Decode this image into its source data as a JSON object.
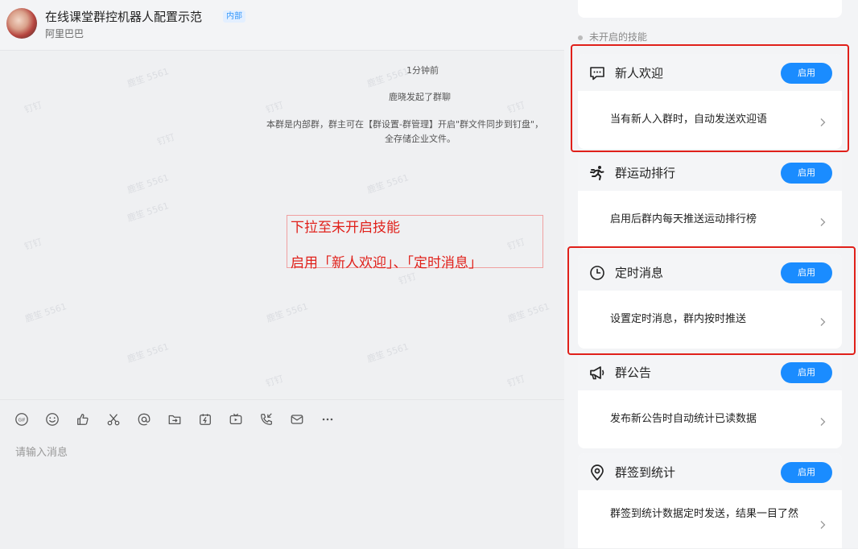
{
  "header": {
    "title": "在线课堂群控机器人配置示范",
    "badge": "内部",
    "org": "阿里巴巴"
  },
  "messages": {
    "time": "1分钟前",
    "started": "鹿晓发起了群聊",
    "notice_line1": "本群是内部群，群主可在【群设置-群管理】开启\"群文件同步到钉盘\"，",
    "notice_line2": "全存储企业文件。"
  },
  "watermarks": [
    "鹿笙 5561",
    "钉钉"
  ],
  "annotation": {
    "line1": "下拉至未开启技能",
    "line2": "启用「新人欢迎」、「定时消息」"
  },
  "composer": {
    "placeholder": "请输入消息",
    "tools": [
      "gif-icon",
      "emoji-icon",
      "thumbs-up-icon",
      "scissors-icon",
      "at-icon",
      "share-icon",
      "flash-icon",
      "tv-icon",
      "phone-icon",
      "mail-icon",
      "more-icon"
    ]
  },
  "panel": {
    "section_title": "未开启的技能",
    "skills": [
      {
        "name": "新人欢迎",
        "icon": "chat-bubble-icon",
        "button": "启用",
        "description": "当有新人入群时，自动发送欢迎语"
      },
      {
        "name": "群运动排行",
        "icon": "runner-icon",
        "button": "启用",
        "description": "启用后群内每天推送运动排行榜"
      },
      {
        "name": "定时消息",
        "icon": "clock-icon",
        "button": "启用",
        "description": "设置定时消息，群内按时推送"
      },
      {
        "name": "群公告",
        "icon": "megaphone-icon",
        "button": "启用",
        "description": "发布新公告时自动统计已读数据"
      },
      {
        "name": "群签到统计",
        "icon": "location-pin-icon",
        "button": "启用",
        "description": "群签到统计数据定时发送，结果一目了然"
      }
    ]
  },
  "colors": {
    "accent": "#1a8cff",
    "annotation": "#e0201a"
  }
}
